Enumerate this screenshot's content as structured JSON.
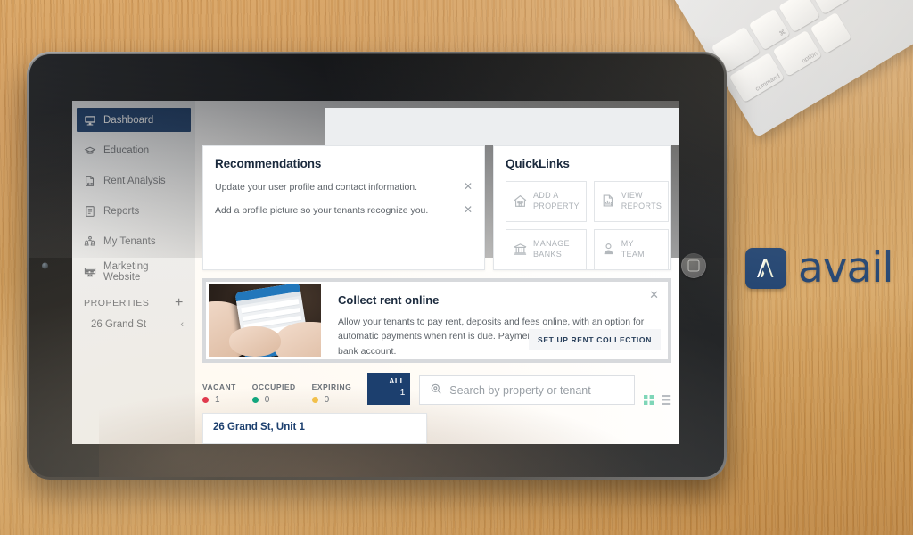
{
  "brand": {
    "name": "avail",
    "mark_icon": "avail-chevron-mark",
    "color": "#1c3f6e"
  },
  "device": {
    "type": "tablet",
    "home_button_icon": "home-button-icon",
    "camera_icon": "front-camera-icon"
  },
  "keyboard": {
    "keys": [
      "⌘",
      "command",
      "⌥",
      "option"
    ]
  },
  "sidebar": {
    "items": [
      {
        "label": "Dashboard",
        "icon": "monitor-icon",
        "active": true
      },
      {
        "label": "Education",
        "icon": "graduation-cap-icon",
        "active": false
      },
      {
        "label": "Rent Analysis",
        "icon": "document-dollar-icon",
        "active": false
      },
      {
        "label": "Reports",
        "icon": "report-document-icon",
        "active": false
      },
      {
        "label": "My Tenants",
        "icon": "people-icon",
        "active": false
      },
      {
        "label": "Marketing Website",
        "icon": "website-icon",
        "active": false
      }
    ],
    "section": {
      "label": "PROPERTIES",
      "add_icon": "plus-icon",
      "add_label": "+"
    },
    "properties": [
      {
        "label": "26 Grand St",
        "icon": "building-icon",
        "collapse_icon": "chevron-left-icon",
        "collapse_glyph": "‹"
      }
    ]
  },
  "recommendations": {
    "title": "Recommendations",
    "dismiss_glyph": "✕",
    "items": [
      {
        "text": "Update your user profile and contact information.",
        "dismiss_icon": "close-icon"
      },
      {
        "text": "Add a profile picture so your tenants recognize you.",
        "dismiss_icon": "close-icon"
      }
    ]
  },
  "quicklinks": {
    "title": "QuickLinks",
    "buttons": [
      {
        "line1": "ADD A",
        "line2": "PROPERTY",
        "icon": "house-icon"
      },
      {
        "line1": "VIEW",
        "line2": "REPORTS",
        "icon": "chart-dollar-icon"
      },
      {
        "line1": "MANAGE",
        "line2": "BANKS",
        "icon": "bank-icon"
      },
      {
        "line1": "MY",
        "line2": "TEAM",
        "icon": "person-icon"
      }
    ]
  },
  "promo": {
    "title": "Collect rent online",
    "body": "Allow your tenants to pay rent, deposits and fees online, with an option for automatic payments when rent is due. Payments deposit directly to your bank account.",
    "cta": "SET UP RENT COLLECTION",
    "dismiss_glyph": "✕",
    "image_alt": "hands-holding-phone-photo"
  },
  "filters": {
    "stats": [
      {
        "label": "VACANT",
        "count": "1",
        "color": "#e03a4e"
      },
      {
        "label": "OCCUPIED",
        "count": "0",
        "color": "#13a67e"
      },
      {
        "label": "EXPIRING",
        "count": "0",
        "color": "#f2c04b"
      }
    ],
    "all": {
      "label": "ALL",
      "count": "1",
      "color": "#1c3f6e"
    },
    "search": {
      "placeholder": "Search by property or tenant",
      "icon": "search-icon",
      "value": ""
    },
    "views": [
      {
        "name": "grid-view-icon",
        "active": true,
        "color": "#7fd6b8"
      },
      {
        "name": "list-view-icon",
        "active": false,
        "color": "#b9bdc2"
      }
    ]
  },
  "property_list": {
    "cards": [
      {
        "address": "26 Grand St, Unit 1"
      }
    ]
  }
}
